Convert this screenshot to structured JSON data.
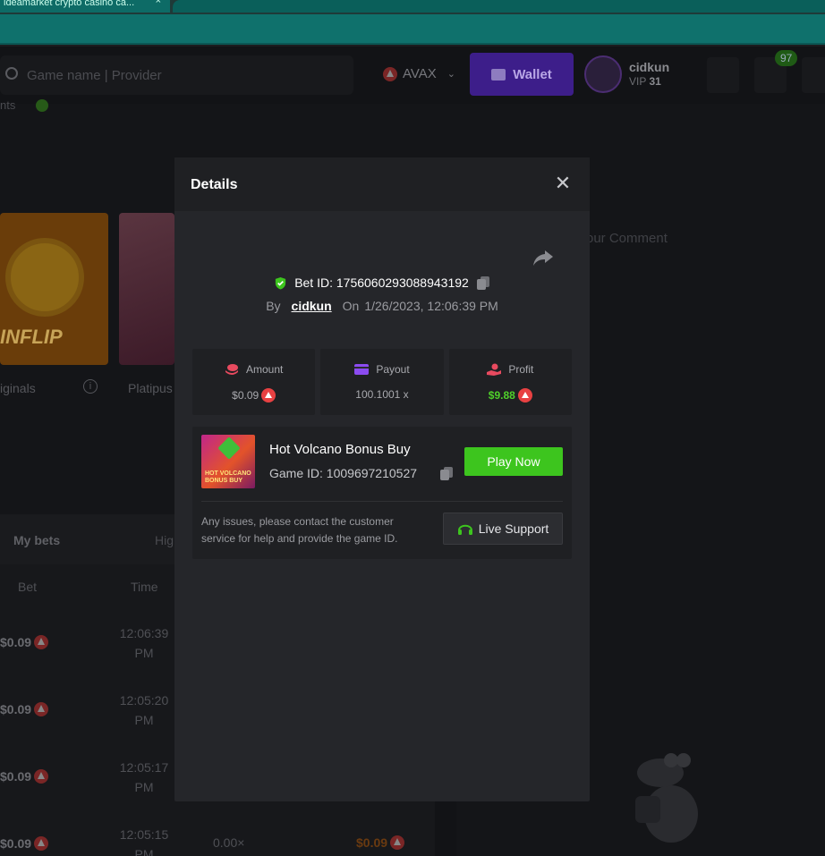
{
  "browser": {
    "tab_title": "ideamarket crypto casino ca..."
  },
  "header": {
    "search_placeholder": "Game name | Provider",
    "currency": "AVAX",
    "wallet_label": "Wallet",
    "username": "cidkun",
    "vip_prefix": "VIP",
    "vip_level": "31",
    "mail_badge": "97"
  },
  "background": {
    "originals_label": "iginals",
    "coinflip_label": "INFLIP",
    "platipus_label": "Platipus",
    "comment_placeholder": "our Comment",
    "tabs": {
      "my_bets": "My bets",
      "high": "Hig"
    },
    "columns": {
      "bet": "Bet",
      "time": "Time"
    },
    "rows": [
      {
        "bet": "$0.09",
        "time": "12:06:39 PM"
      },
      {
        "bet": "$0.09",
        "time": "12:05:20 PM"
      },
      {
        "bet": "$0.09",
        "time": "12:05:17 PM"
      },
      {
        "bet": "$0.09",
        "time": "12:05:15 PM",
        "multiplier": "0.00×",
        "payout": "$0.09"
      }
    ]
  },
  "modal": {
    "title": "Details",
    "bet_id_label": "Bet ID: 1756060293088943192",
    "by_label": "By",
    "user": "cidkun",
    "on_label": "On",
    "datetime": "1/26/2023, 12:06:39 PM",
    "stats": {
      "amount_label": "Amount",
      "amount_value": "$0.09",
      "payout_label": "Payout",
      "payout_value": "100.1001 x",
      "profit_label": "Profit",
      "profit_value": "$9.88"
    },
    "game": {
      "name": "Hot Volcano Bonus Buy",
      "id_label": "Game ID: 1009697210527",
      "thumb_caption": "HOT VOLCANO BONUS BUY",
      "play_label": "Play Now"
    },
    "issue_text": "Any issues, please contact the customer service for help and provide the game ID.",
    "support_label": "Live Support"
  },
  "colors": {
    "accent_green": "#3dc51e",
    "profit_green": "#4fd12a",
    "avax_red": "#e84142",
    "wallet_purple": "#5b2bd1",
    "modal_bg": "#25262a"
  }
}
